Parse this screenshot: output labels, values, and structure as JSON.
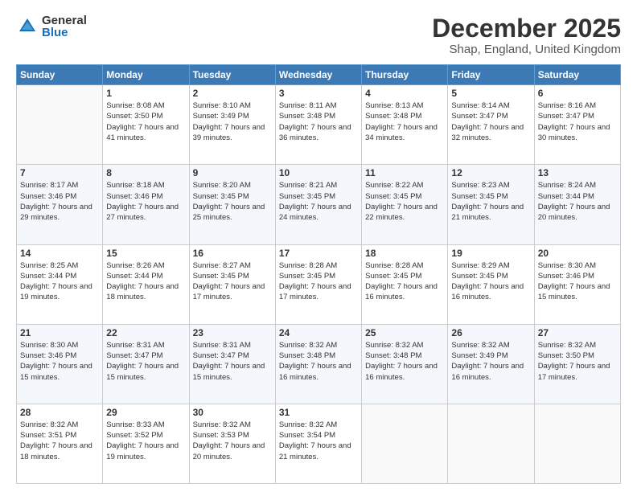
{
  "logo": {
    "general": "General",
    "blue": "Blue"
  },
  "header": {
    "title": "December 2025",
    "subtitle": "Shap, England, United Kingdom"
  },
  "weekdays": [
    "Sunday",
    "Monday",
    "Tuesday",
    "Wednesday",
    "Thursday",
    "Friday",
    "Saturday"
  ],
  "weeks": [
    [
      null,
      {
        "day": 1,
        "sunrise": "8:08 AM",
        "sunset": "3:50 PM",
        "daylight": "7 hours and 41 minutes."
      },
      {
        "day": 2,
        "sunrise": "8:10 AM",
        "sunset": "3:49 PM",
        "daylight": "7 hours and 39 minutes."
      },
      {
        "day": 3,
        "sunrise": "8:11 AM",
        "sunset": "3:48 PM",
        "daylight": "7 hours and 36 minutes."
      },
      {
        "day": 4,
        "sunrise": "8:13 AM",
        "sunset": "3:48 PM",
        "daylight": "7 hours and 34 minutes."
      },
      {
        "day": 5,
        "sunrise": "8:14 AM",
        "sunset": "3:47 PM",
        "daylight": "7 hours and 32 minutes."
      },
      {
        "day": 6,
        "sunrise": "8:16 AM",
        "sunset": "3:47 PM",
        "daylight": "7 hours and 30 minutes."
      }
    ],
    [
      {
        "day": 7,
        "sunrise": "8:17 AM",
        "sunset": "3:46 PM",
        "daylight": "7 hours and 29 minutes."
      },
      {
        "day": 8,
        "sunrise": "8:18 AM",
        "sunset": "3:46 PM",
        "daylight": "7 hours and 27 minutes."
      },
      {
        "day": 9,
        "sunrise": "8:20 AM",
        "sunset": "3:45 PM",
        "daylight": "7 hours and 25 minutes."
      },
      {
        "day": 10,
        "sunrise": "8:21 AM",
        "sunset": "3:45 PM",
        "daylight": "7 hours and 24 minutes."
      },
      {
        "day": 11,
        "sunrise": "8:22 AM",
        "sunset": "3:45 PM",
        "daylight": "7 hours and 22 minutes."
      },
      {
        "day": 12,
        "sunrise": "8:23 AM",
        "sunset": "3:45 PM",
        "daylight": "7 hours and 21 minutes."
      },
      {
        "day": 13,
        "sunrise": "8:24 AM",
        "sunset": "3:44 PM",
        "daylight": "7 hours and 20 minutes."
      }
    ],
    [
      {
        "day": 14,
        "sunrise": "8:25 AM",
        "sunset": "3:44 PM",
        "daylight": "7 hours and 19 minutes."
      },
      {
        "day": 15,
        "sunrise": "8:26 AM",
        "sunset": "3:44 PM",
        "daylight": "7 hours and 18 minutes."
      },
      {
        "day": 16,
        "sunrise": "8:27 AM",
        "sunset": "3:45 PM",
        "daylight": "7 hours and 17 minutes."
      },
      {
        "day": 17,
        "sunrise": "8:28 AM",
        "sunset": "3:45 PM",
        "daylight": "7 hours and 17 minutes."
      },
      {
        "day": 18,
        "sunrise": "8:28 AM",
        "sunset": "3:45 PM",
        "daylight": "7 hours and 16 minutes."
      },
      {
        "day": 19,
        "sunrise": "8:29 AM",
        "sunset": "3:45 PM",
        "daylight": "7 hours and 16 minutes."
      },
      {
        "day": 20,
        "sunrise": "8:30 AM",
        "sunset": "3:46 PM",
        "daylight": "7 hours and 15 minutes."
      }
    ],
    [
      {
        "day": 21,
        "sunrise": "8:30 AM",
        "sunset": "3:46 PM",
        "daylight": "7 hours and 15 minutes."
      },
      {
        "day": 22,
        "sunrise": "8:31 AM",
        "sunset": "3:47 PM",
        "daylight": "7 hours and 15 minutes."
      },
      {
        "day": 23,
        "sunrise": "8:31 AM",
        "sunset": "3:47 PM",
        "daylight": "7 hours and 15 minutes."
      },
      {
        "day": 24,
        "sunrise": "8:32 AM",
        "sunset": "3:48 PM",
        "daylight": "7 hours and 16 minutes."
      },
      {
        "day": 25,
        "sunrise": "8:32 AM",
        "sunset": "3:48 PM",
        "daylight": "7 hours and 16 minutes."
      },
      {
        "day": 26,
        "sunrise": "8:32 AM",
        "sunset": "3:49 PM",
        "daylight": "7 hours and 16 minutes."
      },
      {
        "day": 27,
        "sunrise": "8:32 AM",
        "sunset": "3:50 PM",
        "daylight": "7 hours and 17 minutes."
      }
    ],
    [
      {
        "day": 28,
        "sunrise": "8:32 AM",
        "sunset": "3:51 PM",
        "daylight": "7 hours and 18 minutes."
      },
      {
        "day": 29,
        "sunrise": "8:33 AM",
        "sunset": "3:52 PM",
        "daylight": "7 hours and 19 minutes."
      },
      {
        "day": 30,
        "sunrise": "8:32 AM",
        "sunset": "3:53 PM",
        "daylight": "7 hours and 20 minutes."
      },
      {
        "day": 31,
        "sunrise": "8:32 AM",
        "sunset": "3:54 PM",
        "daylight": "7 hours and 21 minutes."
      },
      null,
      null,
      null
    ]
  ]
}
